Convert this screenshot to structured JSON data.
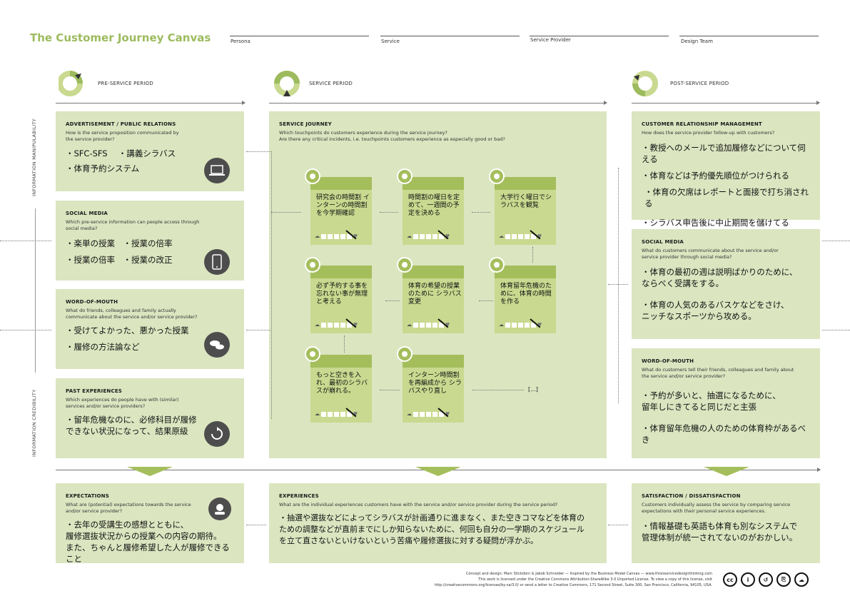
{
  "header": {
    "title": "The Customer Journey Canvas",
    "fields": [
      "Persona",
      "Service",
      "Service Provider",
      "Design Team"
    ]
  },
  "phases": {
    "pre": "PRE-SERVICE PERIOD",
    "service": "SERVICE PERIOD",
    "post": "POST-SERVICE PERIOD"
  },
  "side_labels": {
    "top": "INFORMATION MANIPULABILITY",
    "bottom": "INFORMATION CREDIBILITY"
  },
  "pre": {
    "advertisement": {
      "title": "ADVERTISEMENT / PUBLIC RELATIONS",
      "question": "How is the service proposition communicated by the service provider?",
      "line1": "・SFC-SFS　 ・講義シラバス",
      "line2": "・体育予約システム"
    },
    "social": {
      "title": "SOCIAL MEDIA",
      "question": "Which pre-service information can people access through social media?",
      "line1": "・楽単の授業　・授業の倍率",
      "line2": "・授業の倍率　・授業の改正"
    },
    "wom": {
      "title": "WORD-OF-MOUTH",
      "question": "What do friends, colleagues and family actually communicate about the service and/or service provider?",
      "line1": "・受けてよかった、悪かった授業",
      "line2": "・履修の方法論など"
    },
    "past": {
      "title": "PAST EXPERIENCES",
      "question": "Which experiences do people have with (similar) services and/or service providers?",
      "line1": "・留年危機なのに、必修科目が履修",
      "line2": "できない状況になって、結果原級"
    }
  },
  "journey": {
    "title": "SERVICE JOURNEY",
    "question1": "Which touchpoints do customers experience during the service journey?",
    "question2": "Are there any critical incidents, i.e. touchpoints customers experience as especially good or bad?",
    "cards": [
      "研究会の時間割 インターンの時間割を今学期確認",
      "時間割の曜日を定めて、一週間の予定を決める",
      "大学行く曜日でシラバスを観覧",
      "必ず予約する事を忘れない事が無理と考える",
      "体育の希望の授業のために シラバス変更",
      "体育留年危機のために、体育の時間を作る",
      "もっと空きを入れ、最初のシラバスが崩れる。",
      "インターン時間割を再編成から シラバスやり直し"
    ],
    "ellipsis": "[...]"
  },
  "post": {
    "crm": {
      "title": "CUSTOMER RELATIONSHIP MANAGEMENT",
      "question": "How does the service provider follow-up with customers?",
      "line1": "・教授へのメールで追加履修などについて伺える",
      "line2": "・体育などは予約優先順位がつけられる",
      "line3": "・体育の欠席はレポートと面接で打ち消される",
      "line4": "・シラバス申告後に中止期間を儲けてる"
    },
    "social": {
      "title": "SOCIAL MEDIA",
      "question": "What do customers communicate about the service and/or service provider through social media?",
      "line1": "・体育の最初の週は説明ばかりのために、",
      "line2": "ならべく受講をする。",
      "line3": "・体育の人気のあるバスケなどをさけ、",
      "line4": "ニッチなスポーツから攻める。"
    },
    "wom": {
      "title": "WORD-OF-MOUTH",
      "question": "What do customers tell their friends, colleagues and family about the service and/or service provider?",
      "line1": "・予約が多いと、抽選になるために、",
      "line2": "留年しにきてると同じだと主張",
      "line3": "・体育留年危機の人のための体育枠があるべき"
    }
  },
  "bottom": {
    "expectations": {
      "title": "EXPECTATIONS",
      "question": "What are (potential) expectations towards the service and/or service provider?",
      "line1": "・去年の受講生の感想とともに、",
      "line2": "履修選抜状況からの授業への内容の期待。",
      "line3": "また、ちゃんと履修希望した人が履修できること"
    },
    "experiences": {
      "title": "EXPERIENCES",
      "question": "What are the individual experiences customers have with the service and/or service provider during the service period?",
      "line1": "・抽選や選抜などによってシラバスが計画通りに進まなく、また空きコマなどを体育の",
      "line2": "ための調整などが直前までにしか知らないために、何回も自分の一学期のスケジュール",
      "line3": "を立て直さないといけないという苦痛や履修選抜に対する疑問が浮かぶ。"
    },
    "satisfaction": {
      "title": "SATISFACTION / DISSATISFACTION",
      "question": "Customers individually assess the service by comparing service expectations with their personal service experiences.",
      "line1": "・情報基礎も英語も体育も別なシステムで",
      "line2": "管理体制が統一されてないのがおかしい。"
    }
  },
  "footer": {
    "line1": "Concept and design: Marc Stickdorn & Jakob Schneider — Inspired by the Business Model Canvas — www.thisisservicedesignthinking.com",
    "line2": "This work is licensed under the Creative Commons Attribution-ShareAlike 3.0 Unported License. To view a copy of this license, visit",
    "line3": "http://creativecommons.org/licenses/by-sa/3.0/ or send a letter to Creative Commons, 171 Second Street, Suite 300, San Francisco, California, 94105, USA.",
    "cc_labels": [
      "cc",
      "i",
      "↺",
      "⎘",
      "☁"
    ]
  },
  "colors": {
    "accent": "#9dbb5e",
    "box": "#dbe5c0",
    "card": "#c9d98f",
    "card_top": "#a5be5c"
  }
}
